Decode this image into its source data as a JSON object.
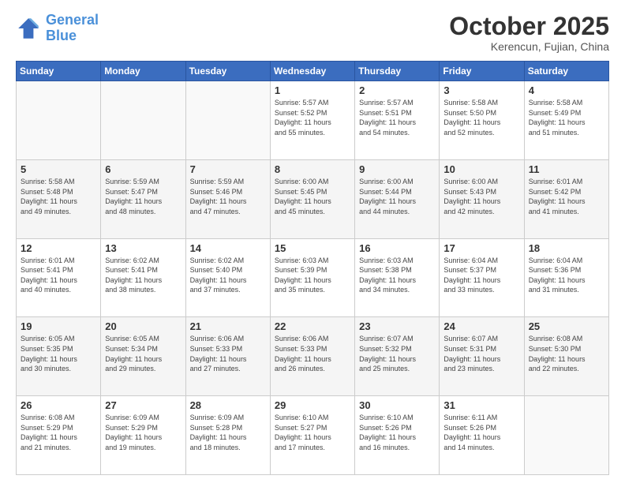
{
  "logo": {
    "line1": "General",
    "line2": "Blue"
  },
  "header": {
    "month": "October 2025",
    "location": "Kerencun, Fujian, China"
  },
  "weekdays": [
    "Sunday",
    "Monday",
    "Tuesday",
    "Wednesday",
    "Thursday",
    "Friday",
    "Saturday"
  ],
  "weeks": [
    [
      {
        "day": "",
        "info": ""
      },
      {
        "day": "",
        "info": ""
      },
      {
        "day": "",
        "info": ""
      },
      {
        "day": "1",
        "info": "Sunrise: 5:57 AM\nSunset: 5:52 PM\nDaylight: 11 hours\nand 55 minutes."
      },
      {
        "day": "2",
        "info": "Sunrise: 5:57 AM\nSunset: 5:51 PM\nDaylight: 11 hours\nand 54 minutes."
      },
      {
        "day": "3",
        "info": "Sunrise: 5:58 AM\nSunset: 5:50 PM\nDaylight: 11 hours\nand 52 minutes."
      },
      {
        "day": "4",
        "info": "Sunrise: 5:58 AM\nSunset: 5:49 PM\nDaylight: 11 hours\nand 51 minutes."
      }
    ],
    [
      {
        "day": "5",
        "info": "Sunrise: 5:58 AM\nSunset: 5:48 PM\nDaylight: 11 hours\nand 49 minutes."
      },
      {
        "day": "6",
        "info": "Sunrise: 5:59 AM\nSunset: 5:47 PM\nDaylight: 11 hours\nand 48 minutes."
      },
      {
        "day": "7",
        "info": "Sunrise: 5:59 AM\nSunset: 5:46 PM\nDaylight: 11 hours\nand 47 minutes."
      },
      {
        "day": "8",
        "info": "Sunrise: 6:00 AM\nSunset: 5:45 PM\nDaylight: 11 hours\nand 45 minutes."
      },
      {
        "day": "9",
        "info": "Sunrise: 6:00 AM\nSunset: 5:44 PM\nDaylight: 11 hours\nand 44 minutes."
      },
      {
        "day": "10",
        "info": "Sunrise: 6:00 AM\nSunset: 5:43 PM\nDaylight: 11 hours\nand 42 minutes."
      },
      {
        "day": "11",
        "info": "Sunrise: 6:01 AM\nSunset: 5:42 PM\nDaylight: 11 hours\nand 41 minutes."
      }
    ],
    [
      {
        "day": "12",
        "info": "Sunrise: 6:01 AM\nSunset: 5:41 PM\nDaylight: 11 hours\nand 40 minutes."
      },
      {
        "day": "13",
        "info": "Sunrise: 6:02 AM\nSunset: 5:41 PM\nDaylight: 11 hours\nand 38 minutes."
      },
      {
        "day": "14",
        "info": "Sunrise: 6:02 AM\nSunset: 5:40 PM\nDaylight: 11 hours\nand 37 minutes."
      },
      {
        "day": "15",
        "info": "Sunrise: 6:03 AM\nSunset: 5:39 PM\nDaylight: 11 hours\nand 35 minutes."
      },
      {
        "day": "16",
        "info": "Sunrise: 6:03 AM\nSunset: 5:38 PM\nDaylight: 11 hours\nand 34 minutes."
      },
      {
        "day": "17",
        "info": "Sunrise: 6:04 AM\nSunset: 5:37 PM\nDaylight: 11 hours\nand 33 minutes."
      },
      {
        "day": "18",
        "info": "Sunrise: 6:04 AM\nSunset: 5:36 PM\nDaylight: 11 hours\nand 31 minutes."
      }
    ],
    [
      {
        "day": "19",
        "info": "Sunrise: 6:05 AM\nSunset: 5:35 PM\nDaylight: 11 hours\nand 30 minutes."
      },
      {
        "day": "20",
        "info": "Sunrise: 6:05 AM\nSunset: 5:34 PM\nDaylight: 11 hours\nand 29 minutes."
      },
      {
        "day": "21",
        "info": "Sunrise: 6:06 AM\nSunset: 5:33 PM\nDaylight: 11 hours\nand 27 minutes."
      },
      {
        "day": "22",
        "info": "Sunrise: 6:06 AM\nSunset: 5:33 PM\nDaylight: 11 hours\nand 26 minutes."
      },
      {
        "day": "23",
        "info": "Sunrise: 6:07 AM\nSunset: 5:32 PM\nDaylight: 11 hours\nand 25 minutes."
      },
      {
        "day": "24",
        "info": "Sunrise: 6:07 AM\nSunset: 5:31 PM\nDaylight: 11 hours\nand 23 minutes."
      },
      {
        "day": "25",
        "info": "Sunrise: 6:08 AM\nSunset: 5:30 PM\nDaylight: 11 hours\nand 22 minutes."
      }
    ],
    [
      {
        "day": "26",
        "info": "Sunrise: 6:08 AM\nSunset: 5:29 PM\nDaylight: 11 hours\nand 21 minutes."
      },
      {
        "day": "27",
        "info": "Sunrise: 6:09 AM\nSunset: 5:29 PM\nDaylight: 11 hours\nand 19 minutes."
      },
      {
        "day": "28",
        "info": "Sunrise: 6:09 AM\nSunset: 5:28 PM\nDaylight: 11 hours\nand 18 minutes."
      },
      {
        "day": "29",
        "info": "Sunrise: 6:10 AM\nSunset: 5:27 PM\nDaylight: 11 hours\nand 17 minutes."
      },
      {
        "day": "30",
        "info": "Sunrise: 6:10 AM\nSunset: 5:26 PM\nDaylight: 11 hours\nand 16 minutes."
      },
      {
        "day": "31",
        "info": "Sunrise: 6:11 AM\nSunset: 5:26 PM\nDaylight: 11 hours\nand 14 minutes."
      },
      {
        "day": "",
        "info": ""
      }
    ]
  ]
}
